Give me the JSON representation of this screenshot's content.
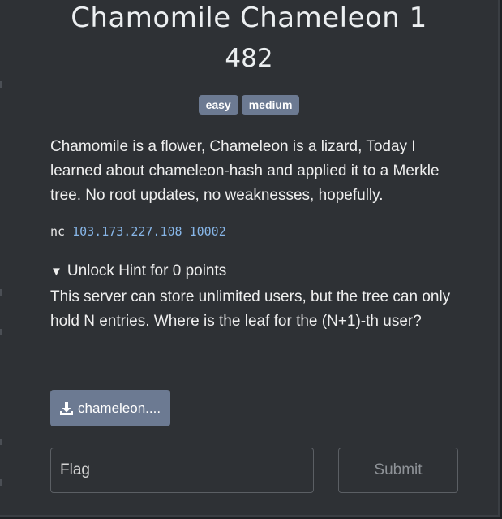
{
  "challenge": {
    "title": "Chamomile Chameleon 1",
    "points": "482",
    "tags": [
      "easy",
      "medium"
    ],
    "description": "Chamomile is a flower, Chameleon is a lizard, Today I learned about chameleon-hash and applied it to a Merkle tree. No root updates, no weaknesses, hopefully.",
    "connection": {
      "prefix": "nc",
      "host": "103.173.227.108",
      "port": "10002"
    }
  },
  "hint": {
    "toggle_icon": "triangle-down-icon",
    "summary": "Unlock Hint for 0 points",
    "body": "This server can store unlimited users, but the tree can only hold N entries. Where is the leaf for the (N+1)-th user?"
  },
  "file": {
    "icon": "download-icon",
    "label": "chameleon...."
  },
  "form": {
    "flag_placeholder": "Flag",
    "submit_label": "Submit"
  },
  "colors": {
    "background": "#2e3135",
    "tag_bg": "#6c7a92",
    "link_blue": "#87b6e8"
  }
}
